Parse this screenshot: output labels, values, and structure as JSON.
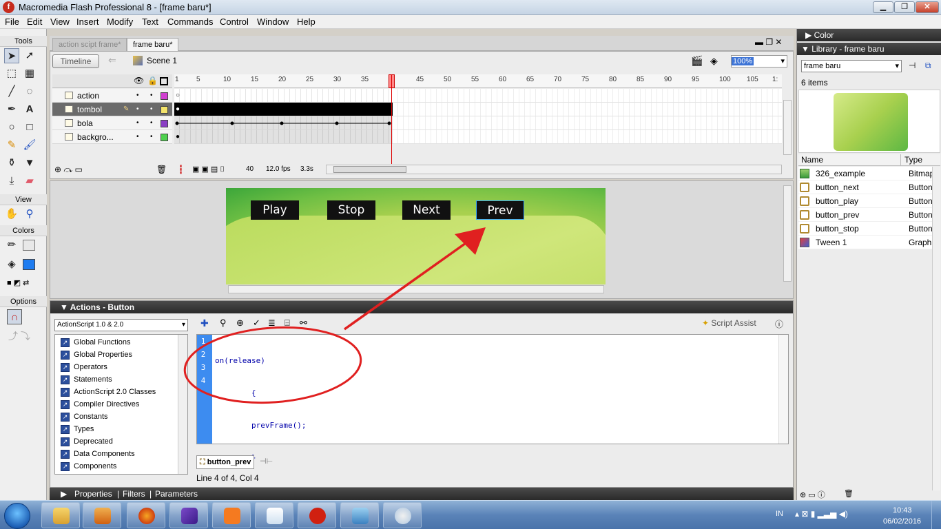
{
  "window": {
    "title": "Macromedia Flash Professional 8 - [frame baru*]",
    "app_icon": "flash-icon",
    "buttons": [
      "minimize",
      "restore",
      "close"
    ]
  },
  "menu": [
    "File",
    "Edit",
    "View",
    "Insert",
    "Modify",
    "Text",
    "Commands",
    "Control",
    "Window",
    "Help"
  ],
  "tools": {
    "header": "Tools",
    "view_header": "View",
    "colors_header": "Colors",
    "options_header": "Options"
  },
  "doc_tabs": [
    {
      "label": "action scipt frame*",
      "active": false
    },
    {
      "label": "frame baru*",
      "active": true
    }
  ],
  "timeline": {
    "toggle_label": "Timeline",
    "scene_label": "Scene 1",
    "zoom": "100%",
    "ruler": [
      "1",
      "5",
      "10",
      "15",
      "20",
      "25",
      "30",
      "35",
      "40",
      "45",
      "50",
      "55",
      "60",
      "65",
      "70",
      "75",
      "80",
      "85",
      "90",
      "95",
      "100",
      "105",
      "1:"
    ],
    "layers": [
      {
        "name": "action",
        "color": "#d13fd1",
        "selected": false
      },
      {
        "name": "tombol",
        "color": "#f3e36a",
        "selected": true
      },
      {
        "name": "bola",
        "color": "#8a3fc4",
        "selected": false
      },
      {
        "name": "backgro...",
        "color": "#4fd14f",
        "selected": false
      }
    ],
    "current_frame": "40",
    "fps": "12.0 fps",
    "time": "3.3s"
  },
  "stage": {
    "buttons": [
      "Play",
      "Stop",
      "Next",
      "Prev"
    ]
  },
  "actions": {
    "header": "Actions - Button",
    "version_select": "ActionScript 1.0 & 2.0",
    "script_assist": "Script Assist",
    "tree": [
      "Global Functions",
      "Global Properties",
      "Operators",
      "Statements",
      "ActionScript 2.0 Classes",
      "Compiler Directives",
      "Constants",
      "Types",
      "Deprecated",
      "Data Components",
      "Components"
    ],
    "code": [
      {
        "num": "1",
        "text": "on(release)"
      },
      {
        "num": "2",
        "text": "        {"
      },
      {
        "num": "3",
        "text": "        prevFrame();"
      },
      {
        "num": "4",
        "text": "        }"
      }
    ],
    "script_tab": "button_prev",
    "status": "Line 4 of 4, Col 4"
  },
  "bottom_tabs": {
    "properties": "Properties",
    "filters": "Filters",
    "parameters": "Parameters"
  },
  "color_panel": {
    "header": "Color"
  },
  "library": {
    "header": "Library - frame baru",
    "document": "frame baru",
    "count": "6 items",
    "col_name": "Name",
    "col_type": "Type",
    "items": [
      {
        "name": "326_example",
        "type": "Bitmap",
        "icon": "bitmap-icon"
      },
      {
        "name": "button_next",
        "type": "Button",
        "icon": "button-symbol-icon"
      },
      {
        "name": "button_play",
        "type": "Button",
        "icon": "button-symbol-icon"
      },
      {
        "name": "button_prev",
        "type": "Button",
        "icon": "button-symbol-icon"
      },
      {
        "name": "button_stop",
        "type": "Button",
        "icon": "button-symbol-icon"
      },
      {
        "name": "Tween 1",
        "type": "Graphic",
        "icon": "graphic-symbol-icon"
      }
    ]
  },
  "taskbar": {
    "language": "IN",
    "time": "10:43",
    "date": "06/02/2016",
    "apps": [
      "explorer-icon",
      "media-player-icon",
      "firefox-icon",
      "visual-studio-icon",
      "xampp-icon",
      "notepad-icon",
      "flash-icon",
      "photo-viewer-icon",
      "paint-icon"
    ]
  },
  "annotation": {
    "color": "#e02020"
  }
}
